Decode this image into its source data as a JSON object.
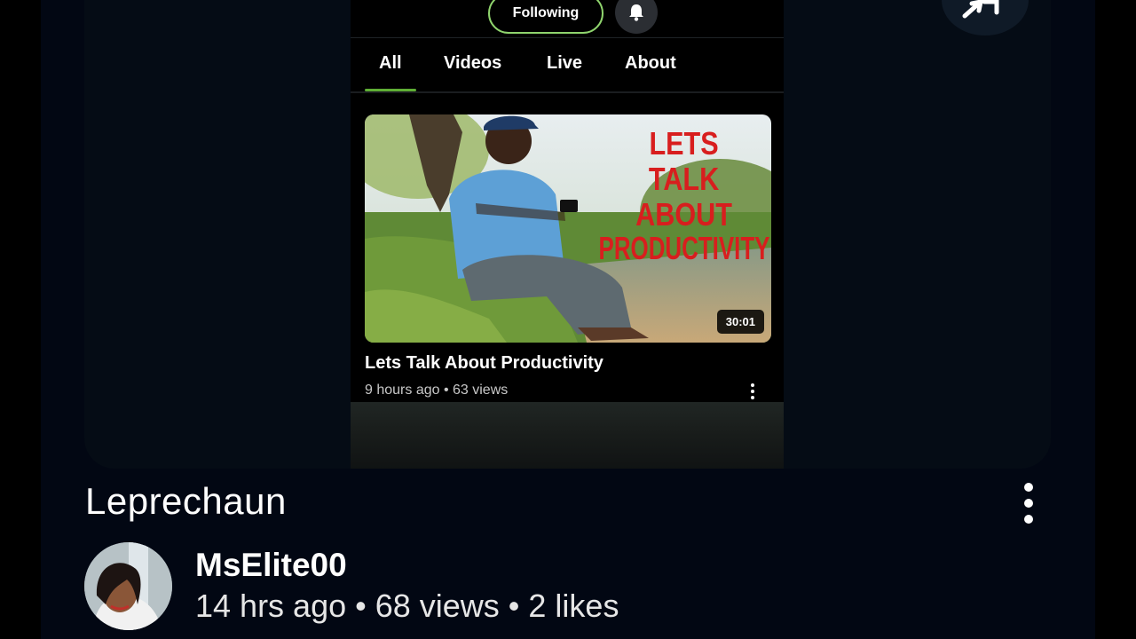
{
  "channel_page": {
    "following_label": "Following",
    "tabs": [
      {
        "label": "All",
        "active": true
      },
      {
        "label": "Videos",
        "active": false
      },
      {
        "label": "Live",
        "active": false
      },
      {
        "label": "About",
        "active": false
      }
    ],
    "video": {
      "thumbnail_text": [
        "LETS",
        "TALK",
        "ABOUT",
        "PRODUCTIVITY"
      ],
      "duration": "30:01",
      "title": "Lets Talk About Productivity",
      "meta": "9 hours ago • 63  views"
    },
    "colors": {
      "accent": "#5fae35",
      "following_border": "#8fd46d"
    }
  },
  "page": {
    "title": "Leprechaun",
    "channel_name": "MsElite00",
    "meta": "14 hrs ago • 68 views • 2 likes"
  },
  "icons": {
    "bell": "bell-icon",
    "corner": "pin-icon",
    "more": "more-vertical-icon"
  }
}
